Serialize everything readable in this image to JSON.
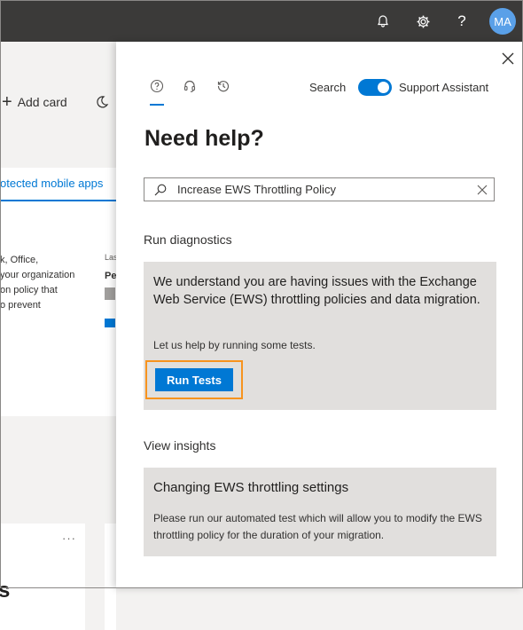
{
  "topbar": {
    "icons": [
      "bell-icon",
      "gear-icon",
      "help-icon"
    ],
    "avatar_initials": "MA"
  },
  "background": {
    "add_card_label": "Add card",
    "tab_label": "otected mobile apps",
    "text_lines": [
      "k, Office,",
      "your organization",
      "on policy that",
      "o prevent"
    ],
    "col2_header": "Las",
    "col2_value": "Pe",
    "more_dots": "···",
    "big_letter": "s"
  },
  "panel": {
    "tabs": [
      "help-circle-icon",
      "headset-icon",
      "history-icon"
    ],
    "search_label": "Search",
    "toggle_on": true,
    "support_assistant_label": "Support Assistant",
    "title": "Need help?",
    "search": {
      "value": "Increase EWS Throttling Policy",
      "placeholder": ""
    },
    "diagnostics": {
      "heading": "Run diagnostics",
      "message": "We understand you are having issues with the Exchange Web Service (EWS) throttling policies and data migration.",
      "sub": "Let us help by running some tests.",
      "button_label": "Run Tests",
      "highlight_color": "#f7931e"
    },
    "insights": {
      "heading": "View insights",
      "card_title": "Changing EWS throttling settings",
      "card_text": "Please run our automated test which will allow you to modify the EWS throttling policy for the duration of your migration."
    }
  },
  "colors": {
    "accent": "#0078d4",
    "topbar": "#3b3a39",
    "card_grey": "#e1dfdd"
  }
}
